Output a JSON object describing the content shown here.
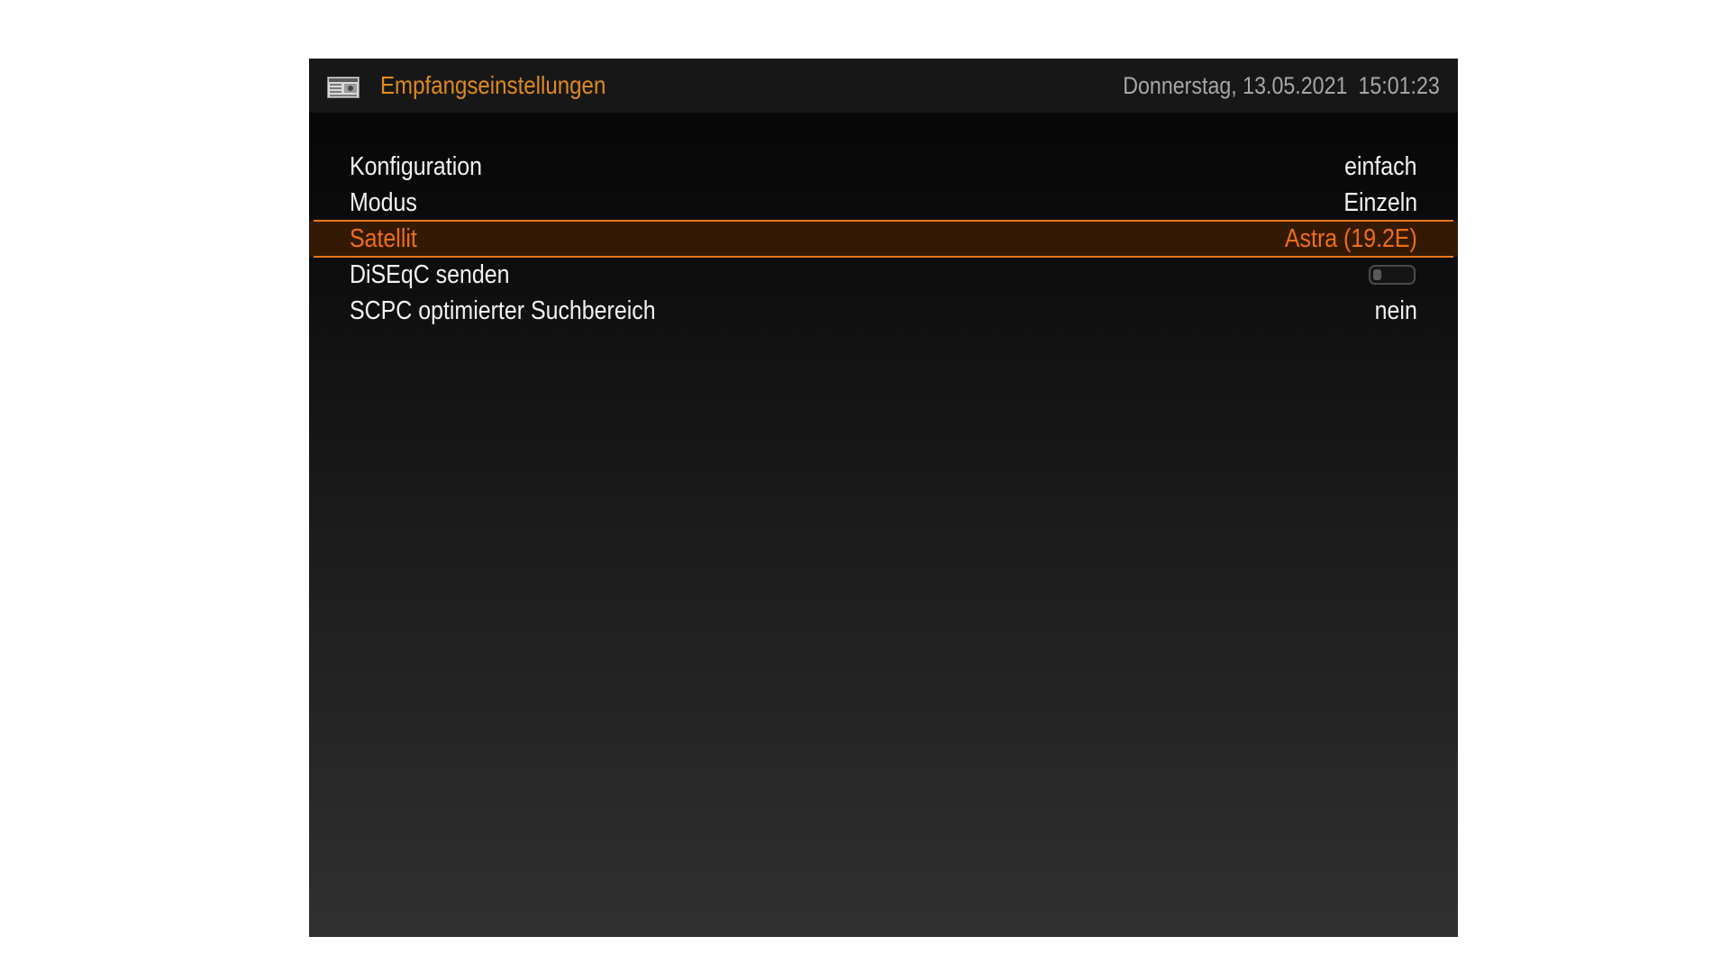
{
  "header": {
    "title": "Empfangseinstellungen",
    "date": "Donnerstag, 13.05.2021",
    "time": "15:01:23",
    "icon": "satellite-dish-settings-icon"
  },
  "settings": [
    {
      "label": "Konfiguration",
      "value": "einfach"
    },
    {
      "label": "Modus",
      "value": "Einzeln"
    },
    {
      "label": "Satellit",
      "value": "Astra (19.2E)",
      "selected": true
    },
    {
      "label": "DiSEqC senden",
      "toggle": "off"
    },
    {
      "label": "SCPC optimierter Suchbereich",
      "value": "nein"
    }
  ],
  "colors": {
    "accent": "#e08a1e",
    "selected_text": "#ee6e18",
    "selected_border": "#e8781a",
    "selected_bg": "#341a05",
    "text": "#f2f2f2",
    "datetime": "#a6a6a6"
  }
}
